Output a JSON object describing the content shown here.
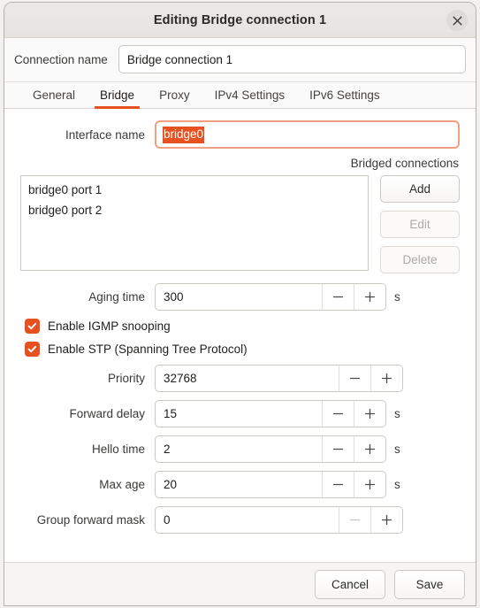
{
  "window": {
    "title": "Editing Bridge connection 1",
    "close_icon": "close-icon"
  },
  "connection": {
    "label": "Connection name",
    "value": "Bridge connection 1",
    "placeholder": ""
  },
  "tabs": [
    {
      "label": "General",
      "active": false
    },
    {
      "label": "Bridge",
      "active": true
    },
    {
      "label": "Proxy",
      "active": false
    },
    {
      "label": "IPv4 Settings",
      "active": false
    },
    {
      "label": "IPv6 Settings",
      "active": false
    }
  ],
  "bridge": {
    "interface_name": {
      "label": "Interface name",
      "value": "bridge0",
      "selected": true
    },
    "bridged_connections": {
      "caption": "Bridged connections",
      "items": [
        "bridge0 port 1",
        "bridge0 port 2"
      ],
      "buttons": [
        {
          "label": "Add",
          "enabled": true
        },
        {
          "label": "Edit",
          "enabled": false
        },
        {
          "label": "Delete",
          "enabled": false
        }
      ]
    },
    "aging_time": {
      "label": "Aging time",
      "value": "300",
      "unit": "s",
      "minus_enabled": true,
      "plus_enabled": true
    },
    "igmp_snooping": {
      "label": "Enable IGMP snooping",
      "checked": true
    },
    "stp": {
      "label": "Enable STP (Spanning Tree Protocol)",
      "checked": true
    },
    "priority": {
      "label": "Priority",
      "value": "32768",
      "unit": "",
      "minus_enabled": true,
      "plus_enabled": true
    },
    "forward_delay": {
      "label": "Forward delay",
      "value": "15",
      "unit": "s",
      "minus_enabled": true,
      "plus_enabled": true
    },
    "hello_time": {
      "label": "Hello time",
      "value": "2",
      "unit": "s",
      "minus_enabled": true,
      "plus_enabled": true
    },
    "max_age": {
      "label": "Max age",
      "value": "20",
      "unit": "s",
      "minus_enabled": true,
      "plus_enabled": true
    },
    "group_forward_mask": {
      "label": "Group forward mask",
      "value": "0",
      "unit": "",
      "minus_enabled": false,
      "plus_enabled": true
    }
  },
  "footer": {
    "cancel_label": "Cancel",
    "save_label": "Save"
  },
  "colors": {
    "accent": "#e6511f",
    "focus_border": "#f0a080",
    "titlebar": "#e9e7e5",
    "disabled_text": "#adaaa6"
  }
}
